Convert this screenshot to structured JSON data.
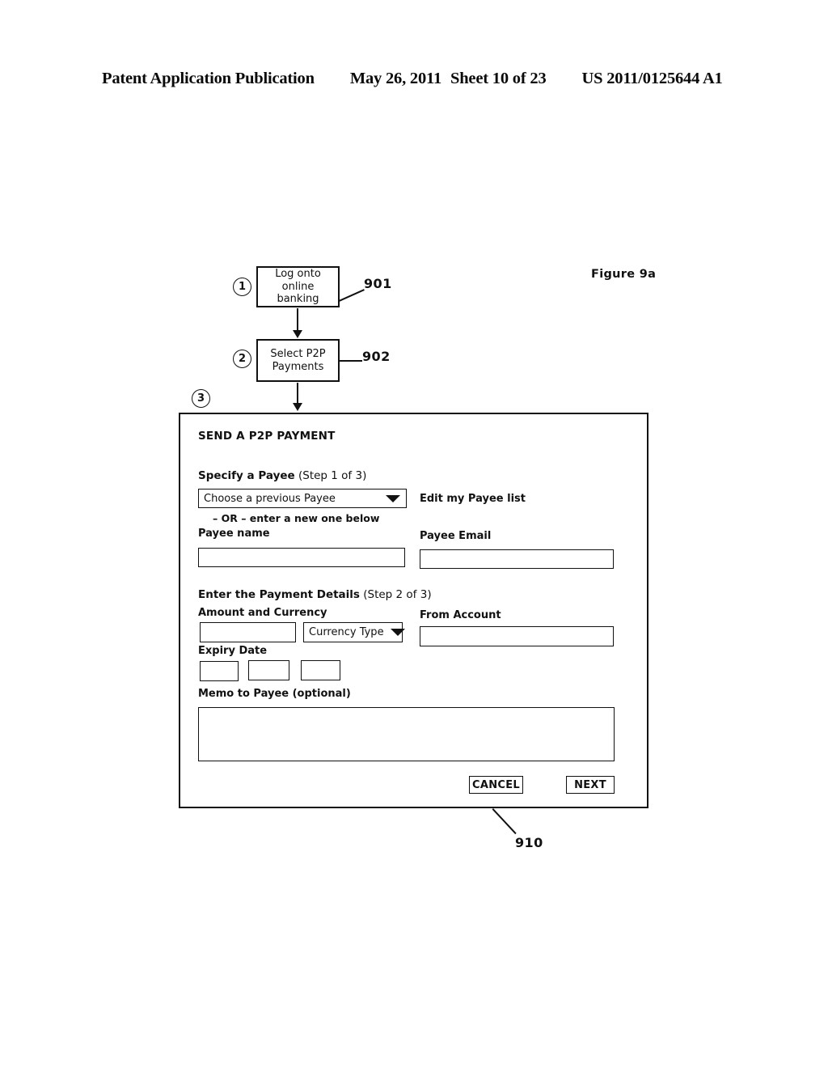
{
  "header": {
    "publication": "Patent Application Publication",
    "date": "May 26, 2011",
    "sheet": "Sheet 10 of 23",
    "patent_number": "US 2011/0125644 A1"
  },
  "figure": {
    "label": "Figure 9a"
  },
  "flowchart": {
    "steps": [
      {
        "marker": "1",
        "text": "Log onto online banking",
        "ref": "901"
      },
      {
        "marker": "2",
        "text": "Select P2P Payments",
        "ref": "902"
      },
      {
        "marker": "3",
        "text": "",
        "ref": "910"
      }
    ],
    "step1_line1": "Log onto online",
    "step1_line2": "banking",
    "step2_line1": "Select P2P",
    "step2_line2": "Payments"
  },
  "panel": {
    "ref": "910",
    "title": "SEND A P2P PAYMENT",
    "step1": {
      "heading_bold": "Specify a Payee",
      "heading_rest": " (Step 1 of 3)",
      "payee_select_value": "Choose a previous Payee",
      "or_text": "– OR – enter a new one below",
      "edit_payee_list_link": "Edit my Payee list",
      "payee_name_label": "Payee name",
      "payee_name_value": "",
      "payee_email_label": "Payee Email",
      "payee_email_value": ""
    },
    "step2": {
      "heading_bold": "Enter the Payment Details",
      "heading_rest": " (Step 2 of 3)",
      "amount_currency_label": "Amount and Currency",
      "amount_value": "",
      "currency_select_value": "Currency Type",
      "from_account_label": "From Account",
      "from_account_value": "",
      "expiry_date_label": "Expiry Date",
      "expiry_1": "",
      "expiry_2": "",
      "expiry_3": "",
      "memo_label": "Memo to Payee (optional)",
      "memo_value": ""
    },
    "buttons": {
      "cancel": "CANCEL",
      "next": "NEXT"
    }
  },
  "colors": {
    "ink": "#111111",
    "paper": "#ffffff"
  }
}
